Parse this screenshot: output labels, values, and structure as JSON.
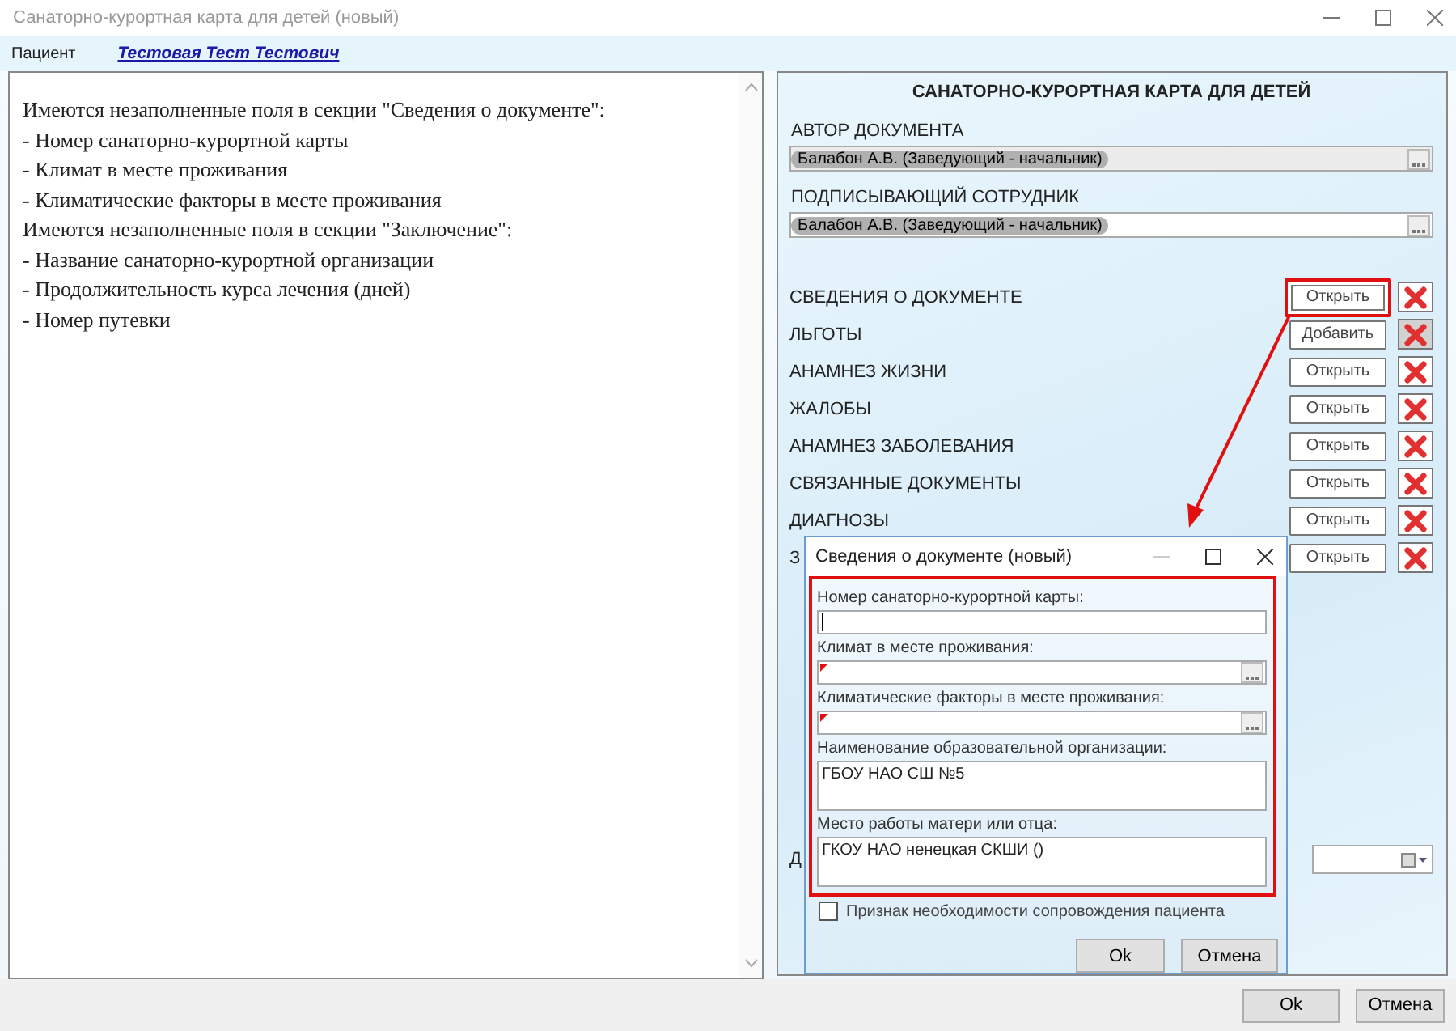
{
  "window": {
    "title": "Санаторно-курортная карта для детей (новый)"
  },
  "patient": {
    "label": "Пациент",
    "name": "Тестовая Тест Тестович"
  },
  "messages": [
    "Имеются незаполненные поля в секции \"Сведения о документе\":",
    "- Номер санаторно-курортной карты",
    "- Климат в месте проживания",
    "- Климатические факторы в месте проживания",
    "Имеются незаполненные поля в секции \"Заключение\":",
    "- Название санаторно-курортной организации",
    "- Продолжительность курса лечения (дней)",
    "- Номер путевки"
  ],
  "card": {
    "title": "САНАТОРНО-КУРОРТНАЯ КАРТА ДЛЯ ДЕТЕЙ",
    "author": {
      "label": "АВТОР ДОКУМЕНТА",
      "value": "Балабон А.В. (Заведующий - начальник)",
      "disabled": true
    },
    "signer": {
      "label": "ПОДПИСЫВАЮЩИЙ СОТРУДНИК",
      "value": "Балабон А.В. (Заведующий - начальник)",
      "disabled": false
    },
    "sections": [
      {
        "label": "СВЕДЕНИЯ О ДОКУМЕНТЕ",
        "button": "Открыть",
        "highlighted": true,
        "delete_disabled": false
      },
      {
        "label": "ЛЬГОТЫ",
        "button": "Добавить",
        "highlighted": false,
        "delete_disabled": true
      },
      {
        "label": "АНАМНЕЗ ЖИЗНИ",
        "button": "Открыть",
        "highlighted": false,
        "delete_disabled": false
      },
      {
        "label": "ЖАЛОБЫ",
        "button": "Открыть",
        "highlighted": false,
        "delete_disabled": false
      },
      {
        "label": "АНАМНЕЗ ЗАБОЛЕВАНИЯ",
        "button": "Открыть",
        "highlighted": false,
        "delete_disabled": false
      },
      {
        "label": "СВЯЗАННЫЕ ДОКУМЕНТЫ",
        "button": "Открыть",
        "highlighted": false,
        "delete_disabled": false
      },
      {
        "label": "ДИАГНОЗЫ",
        "button": "Открыть",
        "highlighted": false,
        "delete_disabled": false
      },
      {
        "label": "З",
        "button": "Открыть",
        "highlighted": false,
        "delete_disabled": false
      }
    ],
    "date_label": "Д"
  },
  "buttons": [
    "Ok",
    "Отмена"
  ],
  "dialog": {
    "title": "Сведения о документе (новый)",
    "highlighted": true,
    "fields": [
      {
        "kind": "text",
        "label": "Номер санаторно-курортной карты:",
        "required": false,
        "focused": true
      },
      {
        "kind": "lookup",
        "label": "Климат в месте проживания:",
        "required": true,
        "focused": false
      },
      {
        "kind": "lookup",
        "label": "Климатические факторы в месте проживания:",
        "required": true,
        "focused": false
      },
      {
        "kind": "textarea",
        "label": "Наименование образовательной организации:",
        "value": "ГБОУ НАО СШ №5",
        "required": false,
        "focused": false
      },
      {
        "kind": "textarea",
        "label": "Место работы матери или отца:",
        "value": "ГКОУ НАО ненецкая СКШИ ()",
        "required": false,
        "focused": false
      }
    ],
    "checkbox": {
      "label": "Признак необходимости сопровождения пациента",
      "checked": false
    },
    "buttons": [
      "Ok",
      "Отмена"
    ]
  }
}
